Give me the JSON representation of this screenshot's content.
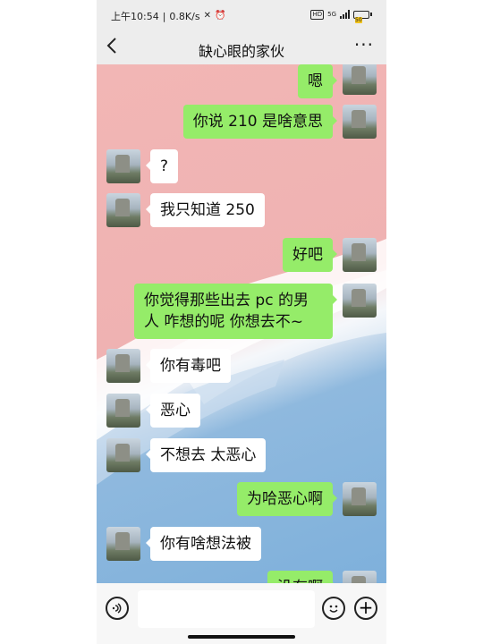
{
  "status_bar": {
    "time": "上午10:54",
    "speed": "0.8K/s",
    "network": "5G",
    "battery": "50"
  },
  "header": {
    "title": "缺心眼的家伙",
    "back_icon": "chevron-left-icon",
    "more_icon": "more-horizontal-icon"
  },
  "messages": [
    {
      "side": "out",
      "text": "嗯"
    },
    {
      "side": "out",
      "text": "你说 210 是啥意思"
    },
    {
      "side": "in",
      "text": "?"
    },
    {
      "side": "in",
      "text": "我只知道 250"
    },
    {
      "side": "out",
      "text": "好吧"
    },
    {
      "side": "out",
      "text": "你觉得那些出去 pc 的男人 咋想的呢  你想去不~"
    },
    {
      "side": "in",
      "text": "你有毒吧"
    },
    {
      "side": "in",
      "text": "恶心"
    },
    {
      "side": "in",
      "text": "不想去 太恶心"
    },
    {
      "side": "out",
      "text": "为哈恶心啊"
    },
    {
      "side": "in",
      "text": "你有啥想法被"
    },
    {
      "side": "out",
      "text": "没有啊"
    }
  ],
  "input_bar": {
    "placeholder": "",
    "voice_icon": "voice-icon",
    "emoji_icon": "emoji-icon",
    "plus_icon": "plus-icon"
  },
  "colors": {
    "outgoing_bubble": "#95ec69",
    "incoming_bubble": "#ffffff",
    "wallpaper_top": "#f2b6b5",
    "wallpaper_bottom": "#7eb0db"
  }
}
